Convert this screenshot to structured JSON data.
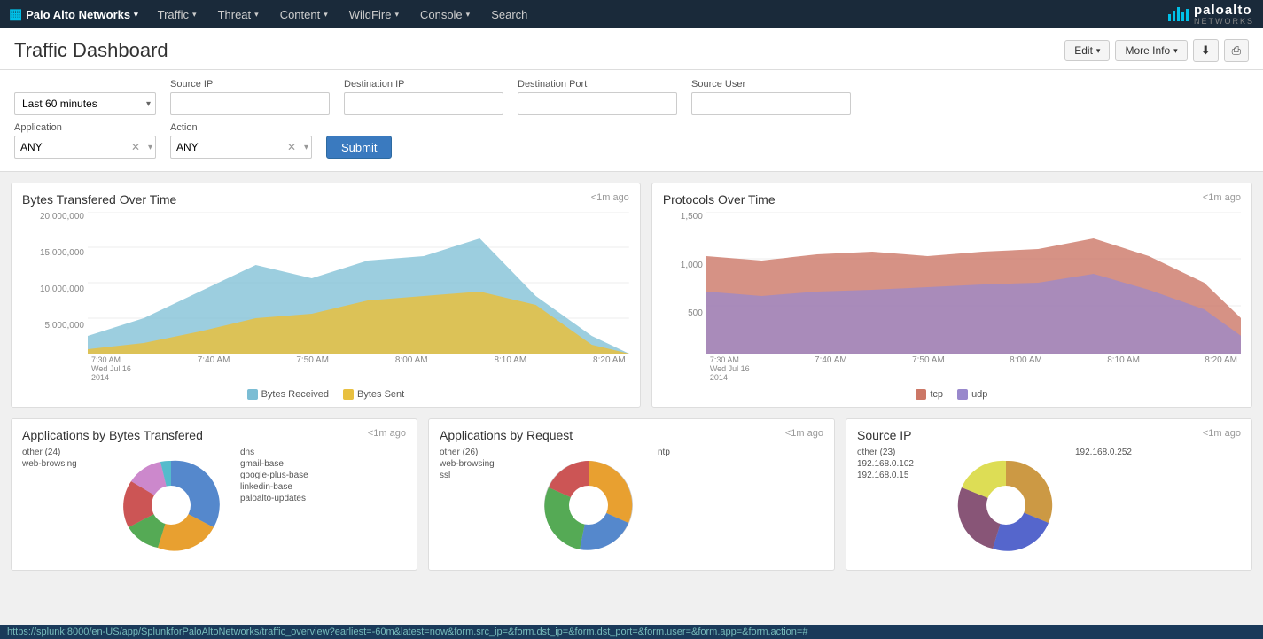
{
  "navbar": {
    "brand": "Palo Alto Networks",
    "items": [
      {
        "label": "Traffic",
        "hasDropdown": true
      },
      {
        "label": "Threat",
        "hasDropdown": true
      },
      {
        "label": "Content",
        "hasDropdown": true
      },
      {
        "label": "WildFire",
        "hasDropdown": true
      },
      {
        "label": "Console",
        "hasDropdown": true
      },
      {
        "label": "Search",
        "hasDropdown": false
      }
    ]
  },
  "page": {
    "title": "Traffic Dashboard",
    "edit_label": "Edit",
    "more_info_label": "More Info"
  },
  "filters": {
    "time_label": "Last 60 minutes",
    "source_ip_label": "Source IP",
    "source_ip_placeholder": "",
    "dest_ip_label": "Destination IP",
    "dest_ip_placeholder": "",
    "dest_port_label": "Destination Port",
    "dest_port_placeholder": "",
    "source_user_label": "Source User",
    "source_user_placeholder": "",
    "application_label": "Application",
    "application_value": "ANY",
    "action_label": "Action",
    "action_value": "ANY",
    "submit_label": "Submit"
  },
  "charts": {
    "bytes_over_time": {
      "title": "Bytes Transfered Over Time",
      "timestamp": "<1m ago",
      "legend": [
        "Bytes Received",
        "Bytes Sent"
      ],
      "y_labels": [
        "20,000,000",
        "15,000,000",
        "10,000,000",
        "5,000,000",
        ""
      ],
      "x_labels": [
        "7:30 AM\nWed Jul 16\n2014",
        "7:40 AM",
        "7:50 AM",
        "8:00 AM",
        "8:10 AM",
        "8:20 AM"
      ]
    },
    "protocols_over_time": {
      "title": "Protocols Over Time",
      "timestamp": "<1m ago",
      "legend": [
        "tcp",
        "udp"
      ],
      "y_labels": [
        "1,500",
        "1,000",
        "500",
        ""
      ],
      "x_labels": [
        "7:30 AM\nWed Jul 16\n2014",
        "7:40 AM",
        "7:50 AM",
        "8:00 AM",
        "8:10 AM",
        "8:20 AM"
      ]
    },
    "apps_bytes": {
      "title": "Applications by Bytes Transfered",
      "timestamp": "<1m ago",
      "labels_left": [
        "other (24)",
        "web-browsing"
      ],
      "labels_right": [
        "dns",
        "gmail-base",
        "google-plus-base",
        "linkedin-base",
        "paloalto-updates"
      ]
    },
    "apps_request": {
      "title": "Applications by Request",
      "timestamp": "<1m ago",
      "labels_left": [
        "other (26)",
        "web-browsing",
        "ssl"
      ],
      "labels_right": [
        "ntp"
      ]
    },
    "source_ip": {
      "title": "Source IP",
      "timestamp": "<1m ago",
      "labels_left": [
        "other (23)",
        "192.168.0.102",
        "192.168.0.15"
      ],
      "labels_right": [
        "192.168.0.252"
      ]
    }
  },
  "status_bar": {
    "url": "https://splunk:8000/en-US/app/SplunkforPaloAltoNetworks/traffic_overview?earliest=-60m&latest=now&form.src_ip=&form.dst_ip=&form.dst_port=&form.user=&form.app=&form.action=#"
  }
}
